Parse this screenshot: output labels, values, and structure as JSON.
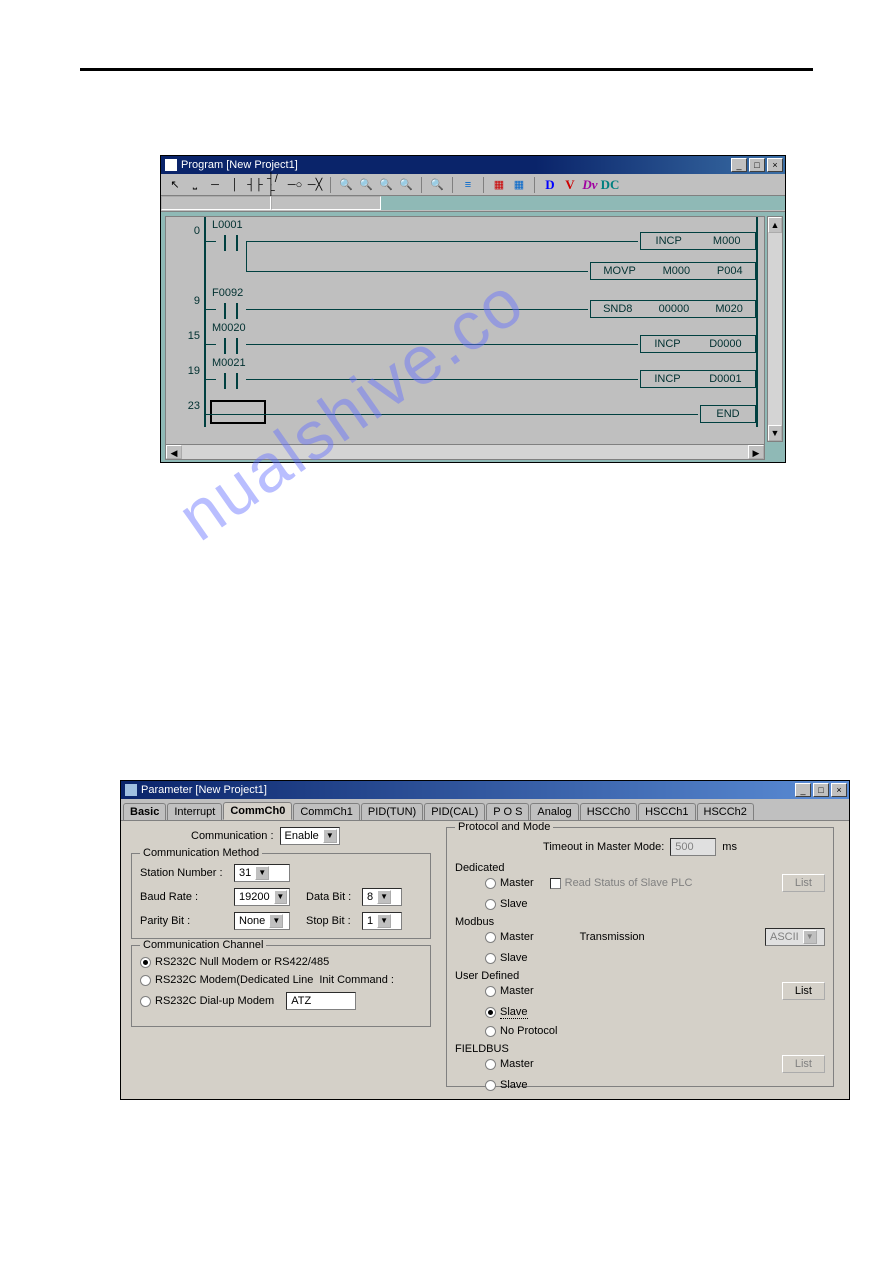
{
  "watermark": "nualshive.co",
  "program_window": {
    "title": "Program [New Project1]",
    "toolbar": {
      "d": "D",
      "v": "V",
      "dv": "Dv",
      "dc": "DC"
    },
    "rungs": [
      {
        "num": "0",
        "contact": "L0001",
        "outputs": [
          {
            "parts": [
              "INCP",
              "M000"
            ]
          },
          {
            "parts": [
              "MOVP",
              "M000",
              "P004"
            ]
          }
        ]
      },
      {
        "num": "9",
        "contact": "F0092",
        "outputs": [
          {
            "parts": [
              "SND8",
              "00000",
              "M020"
            ]
          }
        ]
      },
      {
        "num": "15",
        "contact": "M0020",
        "outputs": [
          {
            "parts": [
              "INCP",
              "D0000"
            ]
          }
        ]
      },
      {
        "num": "19",
        "contact": "M0021",
        "outputs": [
          {
            "parts": [
              "INCP",
              "D0001"
            ]
          }
        ]
      },
      {
        "num": "23",
        "contact": "",
        "outputs": [
          {
            "parts": [
              "END"
            ]
          }
        ]
      }
    ]
  },
  "param_window": {
    "title": "Parameter [New Project1]",
    "tabs": [
      "Basic",
      "Interrupt",
      "CommCh0",
      "CommCh1",
      "PID(TUN)",
      "PID(CAL)",
      "P O S",
      "Analog",
      "HSCCh0",
      "HSCCh1",
      "HSCCh2"
    ],
    "active_tab": "CommCh0",
    "communication_label": "Communication :",
    "communication_value": "Enable",
    "method": {
      "title": "Communication Method",
      "station_label": "Station Number :",
      "station_value": "31",
      "baud_label": "Baud Rate :",
      "baud_value": "19200",
      "parity_label": "Parity Bit :",
      "parity_value": "None",
      "databit_label": "Data Bit :",
      "databit_value": "8",
      "stopbit_label": "Stop Bit :",
      "stopbit_value": "1"
    },
    "channel": {
      "title": "Communication Channel",
      "opt1": "RS232C Null Modem or RS422/485",
      "opt2": "RS232C Modem(Dedicated Line",
      "opt3": "RS232C Dial-up Modem",
      "init_label": "Init Command :",
      "init_value": "ATZ"
    },
    "protocol": {
      "title": "Protocol and Mode",
      "timeout_label": "Timeout in Master Mode:",
      "timeout_value": "500",
      "timeout_unit": "ms",
      "dedicated": "Dedicated",
      "modbus": "Modbus",
      "userdef": "User Defined",
      "fieldbus": "FIELDBUS",
      "master": "Master",
      "slave": "Slave",
      "noproto": "No Protocol",
      "readstatus": "Read Status of Slave PLC",
      "transmission": "Transmission",
      "transmission_value": "ASCII",
      "list": "List"
    }
  }
}
